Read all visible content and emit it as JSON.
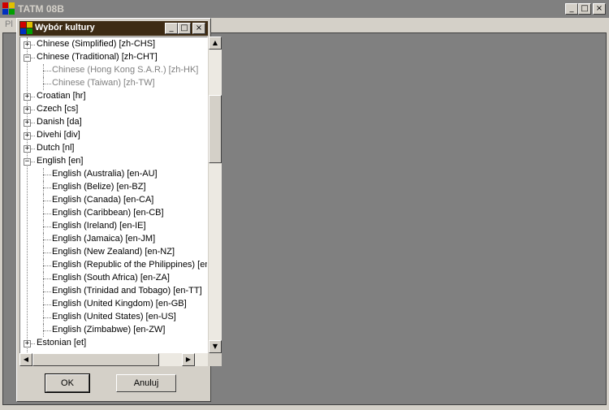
{
  "main_window": {
    "title": "TATM 08B",
    "menu_first": "Pl",
    "controls": {
      "minimize": "_",
      "maximize": "□",
      "close": "×"
    }
  },
  "dialog": {
    "title": "Wybór kultury",
    "controls": {
      "minimize": "_",
      "maximize": "□",
      "close": "×"
    },
    "ok_label": "OK",
    "cancel_label": "Anuluj"
  },
  "tree": {
    "items": [
      {
        "label": "Chinese (Simplified) [zh-CHS]",
        "level": 0,
        "state": "collapsed"
      },
      {
        "label": "Chinese (Traditional) [zh-CHT]",
        "level": 0,
        "state": "expanded"
      },
      {
        "label": "Chinese (Hong Kong S.A.R.) [zh-HK]",
        "level": 1,
        "disabled": true
      },
      {
        "label": "Chinese (Taiwan) [zh-TW]",
        "level": 1,
        "disabled": true
      },
      {
        "label": "Croatian [hr]",
        "level": 0,
        "state": "collapsed"
      },
      {
        "label": "Czech [cs]",
        "level": 0,
        "state": "collapsed"
      },
      {
        "label": "Danish [da]",
        "level": 0,
        "state": "collapsed"
      },
      {
        "label": "Divehi [div]",
        "level": 0,
        "state": "collapsed"
      },
      {
        "label": "Dutch [nl]",
        "level": 0,
        "state": "collapsed"
      },
      {
        "label": "English [en]",
        "level": 0,
        "state": "expanded"
      },
      {
        "label": "English (Australia) [en-AU]",
        "level": 1
      },
      {
        "label": "English (Belize) [en-BZ]",
        "level": 1
      },
      {
        "label": "English (Canada) [en-CA]",
        "level": 1
      },
      {
        "label": "English (Caribbean) [en-CB]",
        "level": 1
      },
      {
        "label": "English (Ireland) [en-IE]",
        "level": 1
      },
      {
        "label": "English (Jamaica) [en-JM]",
        "level": 1
      },
      {
        "label": "English (New Zealand) [en-NZ]",
        "level": 1
      },
      {
        "label": "English (Republic of the Philippines) [en-PH]",
        "level": 1
      },
      {
        "label": "English (South Africa) [en-ZA]",
        "level": 1
      },
      {
        "label": "English (Trinidad and Tobago) [en-TT]",
        "level": 1
      },
      {
        "label": "English (United Kingdom) [en-GB]",
        "level": 1
      },
      {
        "label": "English (United States) [en-US]",
        "level": 1
      },
      {
        "label": "English (Zimbabwe) [en-ZW]",
        "level": 1
      },
      {
        "label": "Estonian [et]",
        "level": 0,
        "state": "collapsed"
      }
    ]
  },
  "scrollbars": {
    "up": "▲",
    "down": "▼",
    "left": "◀",
    "right": "▶"
  },
  "colors": {
    "dialog_title_bg": "#3d2b14",
    "inactive_title_bg": "#808080",
    "workspace": "#808080"
  }
}
